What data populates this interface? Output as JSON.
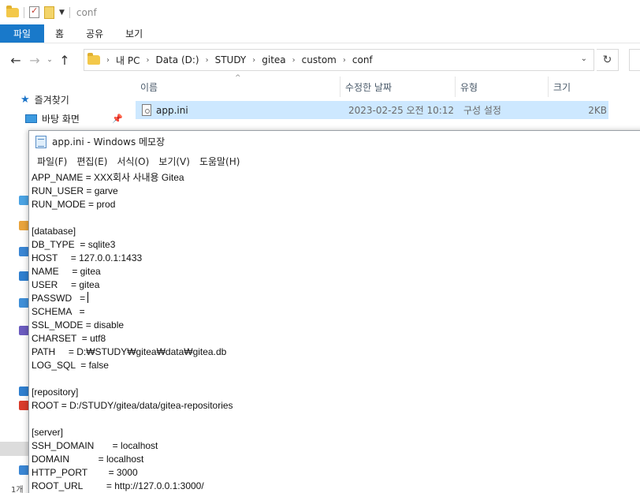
{
  "explorer": {
    "title": "conf",
    "ribbon_tabs": [
      "파일",
      "홈",
      "공유",
      "보기"
    ],
    "breadcrumb": [
      "내 PC",
      "Data (D:)",
      "STUDY",
      "gitea",
      "custom",
      "conf"
    ],
    "columns": {
      "name": "이름",
      "modified": "수정한 날짜",
      "type": "유형",
      "size": "크기"
    },
    "file": {
      "name": "app.ini",
      "modified": "2023-02-25 오전 10:12",
      "type": "구성 설정",
      "size": "2KB"
    },
    "nav": {
      "quick_access": "즐겨찾기",
      "desktop": "바탕 화면"
    },
    "status": "1개"
  },
  "notepad": {
    "title": "app.ini - Windows 메모장",
    "menu": [
      "파일(F)",
      "편집(E)",
      "서식(O)",
      "보기(V)",
      "도움말(H)"
    ],
    "lines": [
      "APP_NAME = XXX회사 사내용 Gitea",
      "RUN_USER = garve",
      "RUN_MODE = prod",
      "",
      "[database]",
      "DB_TYPE  = sqlite3",
      "HOST     = 127.0.0.1:1433",
      "NAME     = gitea",
      "USER     = gitea",
      "PASSWD   = ",
      "SCHEMA   =",
      "SSL_MODE = disable",
      "CHARSET  = utf8",
      "PATH     = D:₩STUDY₩gitea₩data₩gitea.db",
      "LOG_SQL  = false",
      "",
      "[repository]",
      "ROOT = D:/STUDY/gitea/data/gitea-repositories",
      "",
      "[server]",
      "SSH_DOMAIN       = localhost",
      "DOMAIN           = localhost",
      "HTTP_PORT        = 3000",
      "ROOT_URL         = http://127.0.0.1:3000/"
    ]
  }
}
